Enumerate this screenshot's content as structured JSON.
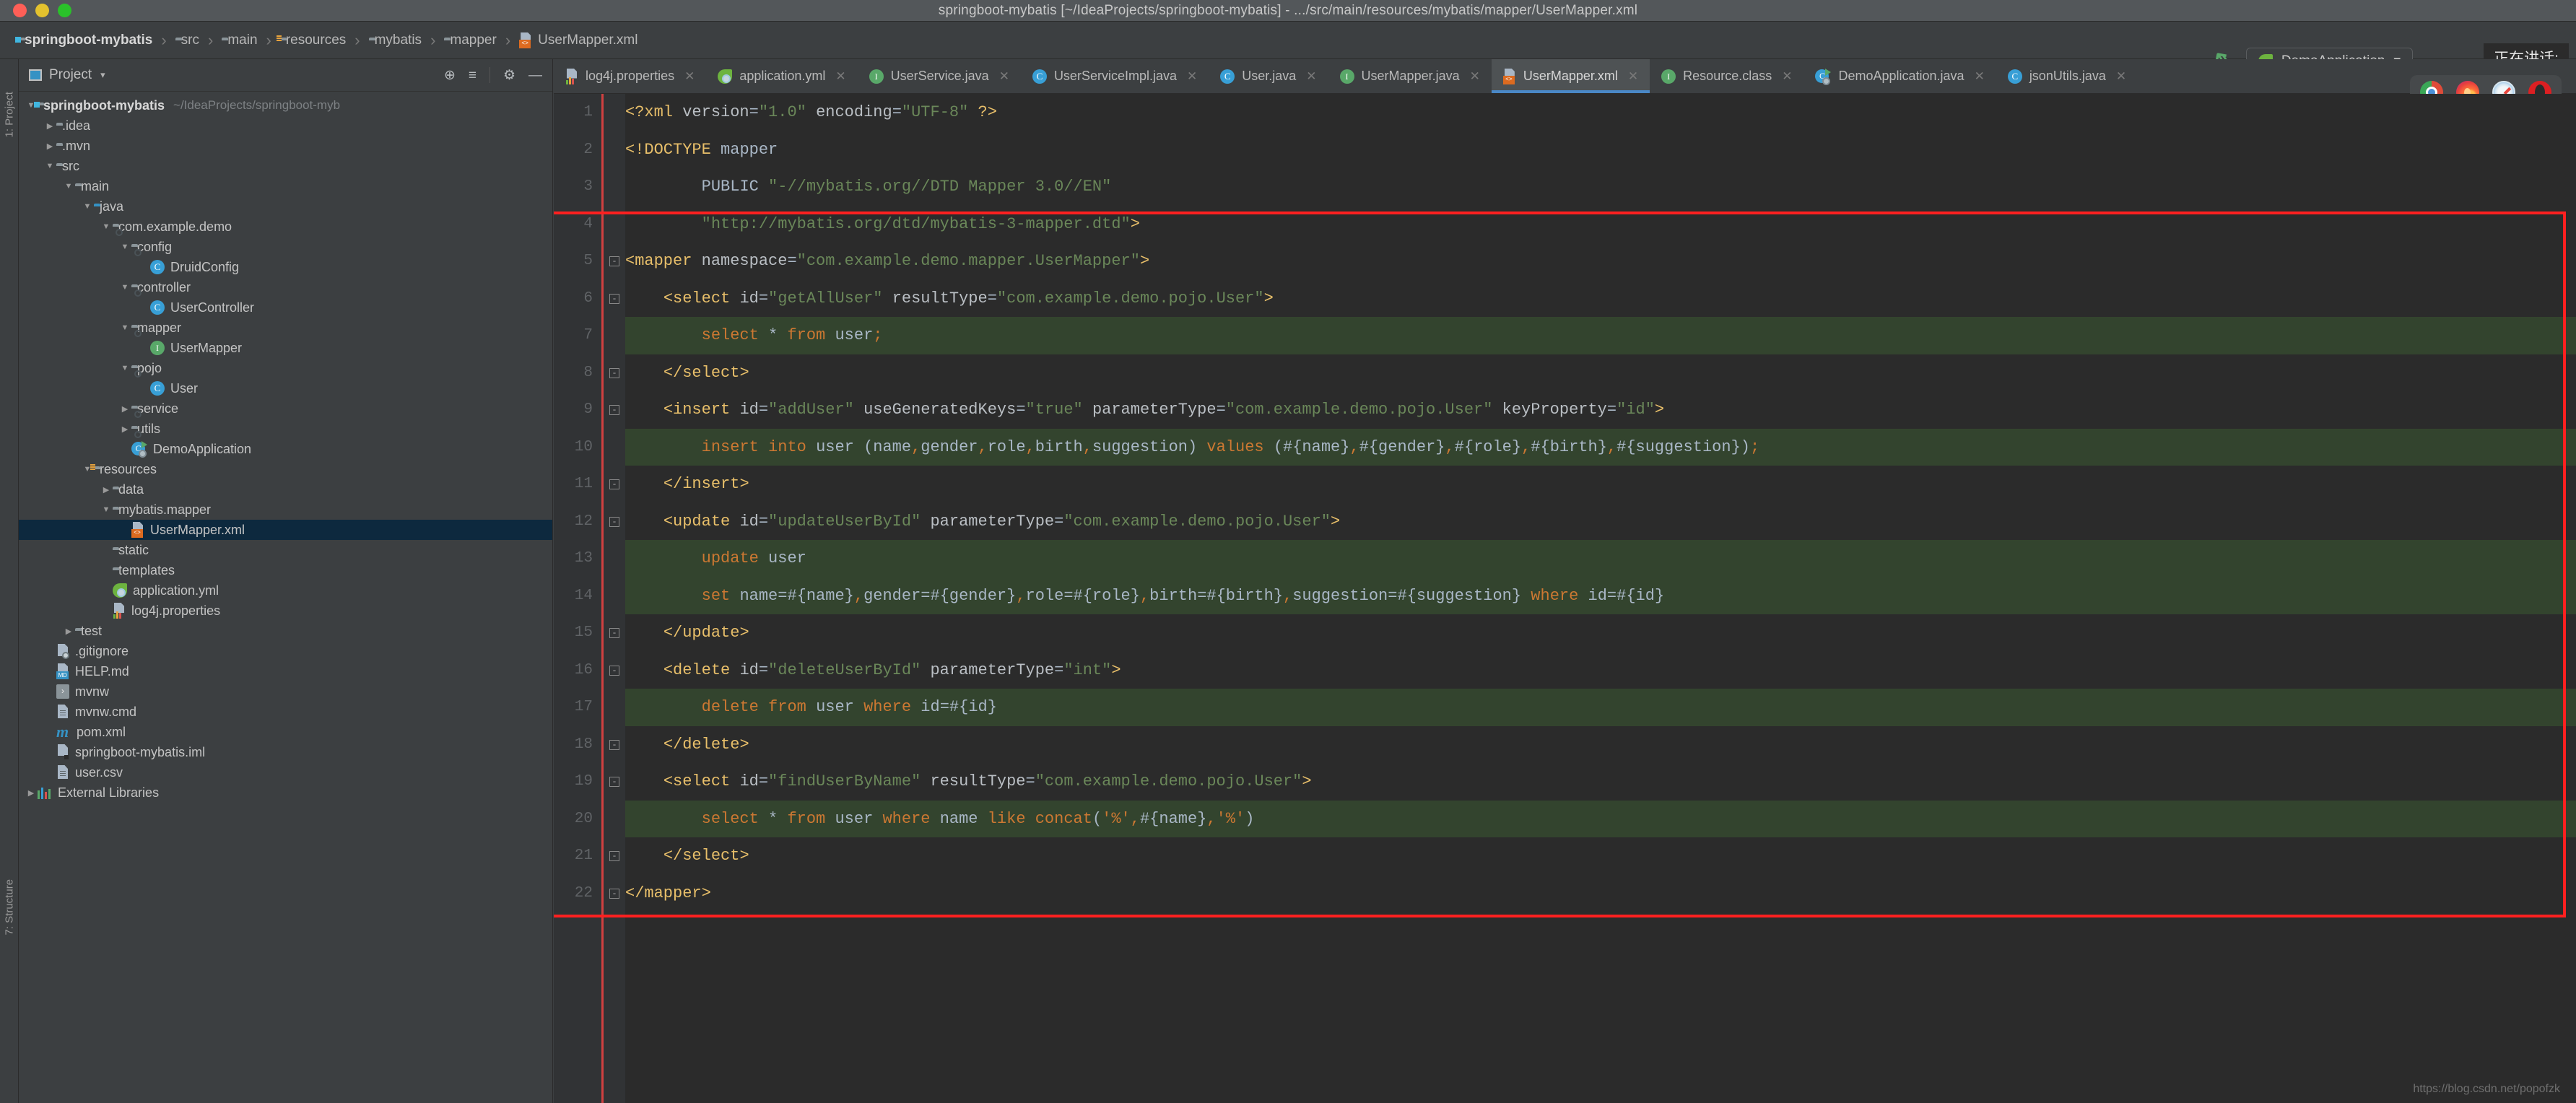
{
  "window": {
    "title": "springboot-mybatis [~/IdeaProjects/springboot-mybatis] - .../src/main/resources/mybatis/mapper/UserMapper.xml",
    "traffic_colors": {
      "close": "#ff5f57",
      "minimize": "#e3c22e",
      "zoom": "#2ac12a"
    }
  },
  "breadcrumb": [
    {
      "label": "springboot-mybatis",
      "icon": "project-folder-icon"
    },
    {
      "label": "src",
      "icon": "folder-icon"
    },
    {
      "label": "main",
      "icon": "folder-icon"
    },
    {
      "label": "resources",
      "icon": "resources-folder-icon"
    },
    {
      "label": "mybatis",
      "icon": "folder-icon"
    },
    {
      "label": "mapper",
      "icon": "folder-icon"
    },
    {
      "label": "UserMapper.xml",
      "icon": "xml-file-icon"
    }
  ],
  "toolbar": {
    "run_config": "DemoApplication",
    "speaking_label": "正在讲话:",
    "separator": "›"
  },
  "project_panel": {
    "title": "Project",
    "caret": "▾",
    "tools": [
      {
        "name": "locate-icon",
        "glyph": "⊕"
      },
      {
        "name": "collapse-all-icon",
        "glyph": "≡"
      },
      {
        "name": "settings-gear-icon",
        "glyph": "⚙"
      },
      {
        "name": "hide-panel-icon",
        "glyph": "—"
      }
    ],
    "side_labels": {
      "top": "1: Project",
      "bottom": "7: Structure"
    },
    "tree": [
      {
        "indent": 0,
        "twisty": "▼",
        "icon": "project-folder-icon",
        "label": "springboot-mybatis",
        "sub": "~/IdeaProjects/springboot-myb",
        "bold": true,
        "selected": false
      },
      {
        "indent": 1,
        "twisty": "▶",
        "icon": "folder-icon",
        "label": ".idea",
        "sub": "",
        "bold": false,
        "selected": false
      },
      {
        "indent": 1,
        "twisty": "▶",
        "icon": "folder-icon",
        "label": ".mvn",
        "sub": "",
        "bold": false,
        "selected": false
      },
      {
        "indent": 1,
        "twisty": "▼",
        "icon": "folder-icon",
        "label": "src",
        "sub": "",
        "bold": false,
        "selected": false
      },
      {
        "indent": 2,
        "twisty": "▼",
        "icon": "folder-icon",
        "label": "main",
        "sub": "",
        "bold": false,
        "selected": false
      },
      {
        "indent": 3,
        "twisty": "▼",
        "icon": "source-folder-icon",
        "label": "java",
        "sub": "",
        "bold": false,
        "selected": false
      },
      {
        "indent": 4,
        "twisty": "▼",
        "icon": "package-icon",
        "label": "com.example.demo",
        "sub": "",
        "bold": false,
        "selected": false
      },
      {
        "indent": 5,
        "twisty": "▼",
        "icon": "package-icon",
        "label": "config",
        "sub": "",
        "bold": false,
        "selected": false
      },
      {
        "indent": 6,
        "twisty": "",
        "icon": "class-icon",
        "label": "DruidConfig",
        "sub": "",
        "bold": false,
        "selected": false
      },
      {
        "indent": 5,
        "twisty": "▼",
        "icon": "package-icon",
        "label": "controller",
        "sub": "",
        "bold": false,
        "selected": false
      },
      {
        "indent": 6,
        "twisty": "",
        "icon": "class-icon",
        "label": "UserController",
        "sub": "",
        "bold": false,
        "selected": false
      },
      {
        "indent": 5,
        "twisty": "▼",
        "icon": "package-icon",
        "label": "mapper",
        "sub": "",
        "bold": false,
        "selected": false
      },
      {
        "indent": 6,
        "twisty": "",
        "icon": "interface-icon",
        "label": "UserMapper",
        "sub": "",
        "bold": false,
        "selected": false
      },
      {
        "indent": 5,
        "twisty": "▼",
        "icon": "package-icon",
        "label": "pojo",
        "sub": "",
        "bold": false,
        "selected": false
      },
      {
        "indent": 6,
        "twisty": "",
        "icon": "class-icon",
        "label": "User",
        "sub": "",
        "bold": false,
        "selected": false
      },
      {
        "indent": 5,
        "twisty": "▶",
        "icon": "package-icon",
        "label": "service",
        "sub": "",
        "bold": false,
        "selected": false
      },
      {
        "indent": 5,
        "twisty": "▶",
        "icon": "package-icon",
        "label": "utils",
        "sub": "",
        "bold": false,
        "selected": false
      },
      {
        "indent": 5,
        "twisty": "",
        "icon": "spring-run-icon",
        "label": "DemoApplication",
        "sub": "",
        "bold": false,
        "selected": false
      },
      {
        "indent": 3,
        "twisty": "▼",
        "icon": "resources-folder-icon",
        "label": "resources",
        "sub": "",
        "bold": false,
        "selected": false
      },
      {
        "indent": 4,
        "twisty": "▶",
        "icon": "folder-icon",
        "label": "data",
        "sub": "",
        "bold": false,
        "selected": false
      },
      {
        "indent": 4,
        "twisty": "▼",
        "icon": "folder-icon",
        "label": "mybatis.mapper",
        "sub": "",
        "bold": false,
        "selected": false
      },
      {
        "indent": 5,
        "twisty": "",
        "icon": "xml-file-icon",
        "label": "UserMapper.xml",
        "sub": "",
        "bold": false,
        "selected": true
      },
      {
        "indent": 4,
        "twisty": "",
        "icon": "folder-icon",
        "label": "static",
        "sub": "",
        "bold": false,
        "selected": false
      },
      {
        "indent": 4,
        "twisty": "",
        "icon": "folder-icon",
        "label": "templates",
        "sub": "",
        "bold": false,
        "selected": false
      },
      {
        "indent": 4,
        "twisty": "",
        "icon": "spring-yaml-icon",
        "label": "application.yml",
        "sub": "",
        "bold": false,
        "selected": false
      },
      {
        "indent": 4,
        "twisty": "",
        "icon": "properties-file-icon",
        "label": "log4j.properties",
        "sub": "",
        "bold": false,
        "selected": false
      },
      {
        "indent": 2,
        "twisty": "▶",
        "icon": "folder-icon",
        "label": "test",
        "sub": "",
        "bold": false,
        "selected": false
      },
      {
        "indent": 1,
        "twisty": "",
        "icon": "gitignore-file-icon",
        "label": ".gitignore",
        "sub": "",
        "bold": false,
        "selected": false
      },
      {
        "indent": 1,
        "twisty": "",
        "icon": "markdown-file-icon",
        "label": "HELP.md",
        "sub": "",
        "bold": false,
        "selected": false
      },
      {
        "indent": 1,
        "twisty": "",
        "icon": "shell-script-icon",
        "label": "mvnw",
        "sub": "",
        "bold": false,
        "selected": false
      },
      {
        "indent": 1,
        "twisty": "",
        "icon": "plain-file-icon",
        "label": "mvnw.cmd",
        "sub": "",
        "bold": false,
        "selected": false
      },
      {
        "indent": 1,
        "twisty": "",
        "icon": "maven-icon",
        "label": "pom.xml",
        "sub": "",
        "bold": false,
        "selected": false
      },
      {
        "indent": 1,
        "twisty": "",
        "icon": "iml-file-icon",
        "label": "springboot-mybatis.iml",
        "sub": "",
        "bold": false,
        "selected": false
      },
      {
        "indent": 1,
        "twisty": "",
        "icon": "plain-file-icon",
        "label": "user.csv",
        "sub": "",
        "bold": false,
        "selected": false
      },
      {
        "indent": 0,
        "twisty": "▶",
        "icon": "external-libraries-icon",
        "label": "External Libraries",
        "sub": "",
        "bold": false,
        "selected": false
      }
    ]
  },
  "editor": {
    "tabs": [
      {
        "label": "log4j.properties",
        "icon": "properties-file-icon",
        "active": false
      },
      {
        "label": "application.yml",
        "icon": "spring-yaml-icon",
        "active": false
      },
      {
        "label": "UserService.java",
        "icon": "interface-icon",
        "active": false
      },
      {
        "label": "UserServiceImpl.java",
        "icon": "class-icon",
        "active": false
      },
      {
        "label": "User.java",
        "icon": "class-icon",
        "active": false
      },
      {
        "label": "UserMapper.java",
        "icon": "interface-icon",
        "active": false
      },
      {
        "label": "UserMapper.xml",
        "icon": "xml-file-icon",
        "active": true
      },
      {
        "label": "Resource.class",
        "icon": "interface-locked-icon",
        "active": false
      },
      {
        "label": "DemoApplication.java",
        "icon": "spring-run-icon",
        "active": false
      },
      {
        "label": "jsonUtils.java",
        "icon": "class-icon",
        "active": false
      }
    ],
    "tab_close_glyph": "✕",
    "browsers": [
      {
        "name": "chrome-icon"
      },
      {
        "name": "firefox-icon"
      },
      {
        "name": "safari-icon"
      },
      {
        "name": "opera-icon"
      }
    ],
    "line_numbers": [
      "1",
      "2",
      "3",
      "4",
      "5",
      "6",
      "7",
      "8",
      "9",
      "10",
      "11",
      "12",
      "13",
      "14",
      "15",
      "16",
      "17",
      "18",
      "19",
      "20",
      "21",
      "22"
    ],
    "code_lines": [
      {
        "n": "1",
        "sql": false,
        "fold": "",
        "text": "<?xml version=\"1.0\" encoding=\"UTF-8\" ?>"
      },
      {
        "n": "2",
        "sql": false,
        "fold": "",
        "text": "<!DOCTYPE mapper"
      },
      {
        "n": "3",
        "sql": false,
        "fold": "",
        "text": "        PUBLIC \"-//mybatis.org//DTD Mapper 3.0//EN\""
      },
      {
        "n": "4",
        "sql": false,
        "fold": "",
        "text": "        \"http://mybatis.org/dtd/mybatis-3-mapper.dtd\">"
      },
      {
        "n": "5",
        "sql": false,
        "fold": "-",
        "text": "<mapper namespace=\"com.example.demo.mapper.UserMapper\">"
      },
      {
        "n": "6",
        "sql": false,
        "fold": "-",
        "text": "    <select id=\"getAllUser\" resultType=\"com.example.demo.pojo.User\">"
      },
      {
        "n": "7",
        "sql": true,
        "fold": "",
        "text": "        select * from user;"
      },
      {
        "n": "8",
        "sql": false,
        "fold": "-",
        "text": "    </select>"
      },
      {
        "n": "9",
        "sql": false,
        "fold": "-",
        "text": "    <insert id=\"addUser\" useGeneratedKeys=\"true\" parameterType=\"com.example.demo.pojo.User\" keyProperty=\"id\">"
      },
      {
        "n": "10",
        "sql": true,
        "fold": "",
        "text": "        insert into user (name,gender,role,birth,suggestion) values (#{name},#{gender},#{role},#{birth},#{suggestion});"
      },
      {
        "n": "11",
        "sql": false,
        "fold": "-",
        "text": "    </insert>"
      },
      {
        "n": "12",
        "sql": false,
        "fold": "-",
        "text": "    <update id=\"updateUserById\" parameterType=\"com.example.demo.pojo.User\">"
      },
      {
        "n": "13",
        "sql": true,
        "fold": "",
        "text": "        update user"
      },
      {
        "n": "14",
        "sql": true,
        "fold": "",
        "text": "        set name=#{name},gender=#{gender},role=#{role},birth=#{birth},suggestion=#{suggestion} where id=#{id}"
      },
      {
        "n": "15",
        "sql": false,
        "fold": "-",
        "text": "    </update>"
      },
      {
        "n": "16",
        "sql": false,
        "fold": "-",
        "text": "    <delete id=\"deleteUserById\" parameterType=\"int\">"
      },
      {
        "n": "17",
        "sql": true,
        "fold": "",
        "text": "        delete from user where id=#{id}"
      },
      {
        "n": "18",
        "sql": false,
        "fold": "-",
        "text": "    </delete>"
      },
      {
        "n": "19",
        "sql": false,
        "fold": "-",
        "text": "    <select id=\"findUserByName\" resultType=\"com.example.demo.pojo.User\">"
      },
      {
        "n": "20",
        "sql": true,
        "fold": "",
        "text": "        select * from user where name like concat('%',#{name},'%')"
      },
      {
        "n": "21",
        "sql": false,
        "fold": "-",
        "text": "    </select>"
      },
      {
        "n": "22",
        "sql": false,
        "fold": "-",
        "text": "</mapper>"
      }
    ],
    "annotation": {
      "name": "red-highlight-box",
      "color": "#ff2020"
    }
  },
  "watermark": "https://blog.csdn.net/popofzk",
  "colors": {
    "window_bg": "#3c3f41",
    "editor_bg": "#2b2b2b",
    "gutter_bg": "#313335",
    "sql_block_bg": "#33442e",
    "selection_bg": "#0d293e",
    "tab_active_bg": "#4e5254",
    "tab_underline": "#4a88c7",
    "tag_color": "#e8bf6a",
    "attr_color": "#babfc4",
    "string_color": "#6a8759",
    "keyword_color": "#cc7832",
    "text_color": "#a9b7c6",
    "error_stripe": "#d04040"
  }
}
